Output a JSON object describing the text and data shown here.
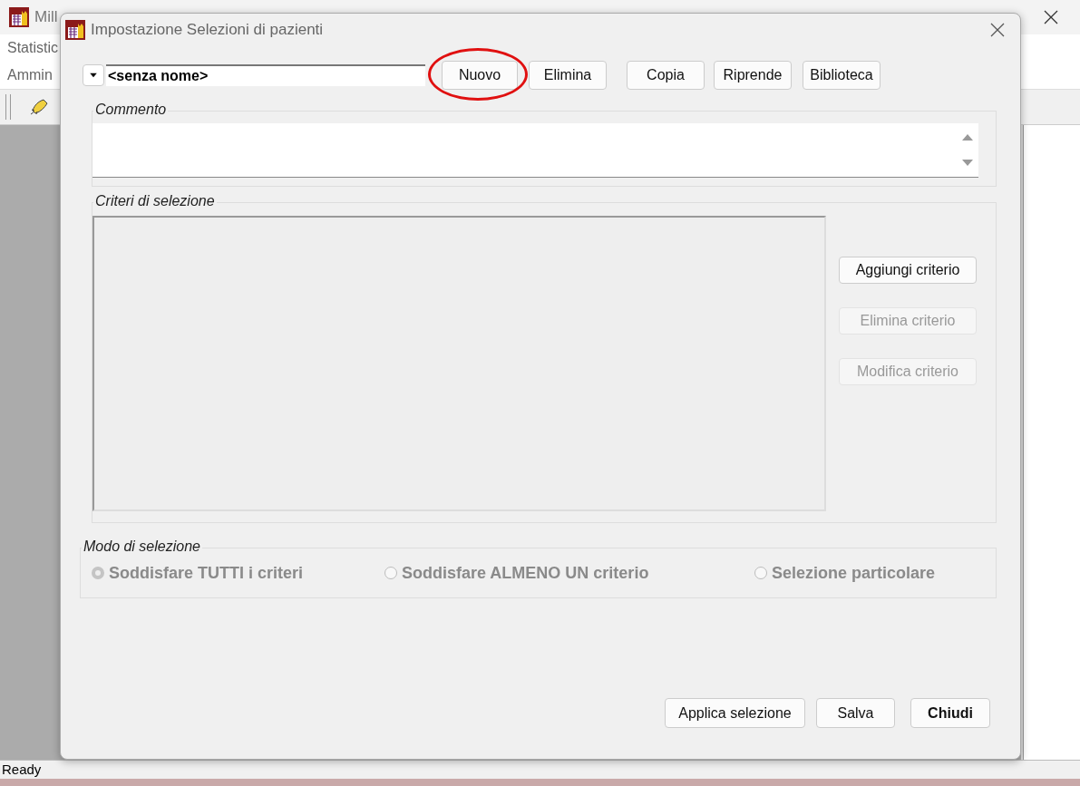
{
  "app": {
    "title": "Mill",
    "menus": [
      "Statistic",
      "Ammin"
    ],
    "status_bar": "Ready"
  },
  "dialog": {
    "title": "Impostazione Selezioni di pazienti",
    "selection_name": "<senza nome>",
    "top_buttons": [
      {
        "label": "Nuovo",
        "circled": true
      },
      {
        "label": "Elimina",
        "circled": false
      },
      {
        "label": "Copia",
        "circled": false
      },
      {
        "label": "Riprende",
        "circled": false
      },
      {
        "label": "Biblioteca",
        "circled": false
      }
    ],
    "comment": {
      "label": "Commento"
    },
    "criteria": {
      "label": "Criteri di selezione",
      "buttons": [
        {
          "label": "Aggiungi criterio",
          "disabled": false
        },
        {
          "label": "Elimina criterio",
          "disabled": true
        },
        {
          "label": "Modifica criterio",
          "disabled": true
        }
      ]
    },
    "mode": {
      "label": "Modo di selezione",
      "options": [
        {
          "label": "Soddisfare TUTTI i criteri",
          "selected": true,
          "disabled": true
        },
        {
          "label": "Soddisfare ALMENO UN criterio",
          "selected": false,
          "disabled": true
        },
        {
          "label": "Selezione particolare",
          "selected": false,
          "disabled": true
        }
      ]
    },
    "bottom_buttons": [
      {
        "label": "Applica selezione",
        "default": false
      },
      {
        "label": "Salva",
        "default": false
      },
      {
        "label": "Chiudi",
        "default": true
      }
    ]
  }
}
